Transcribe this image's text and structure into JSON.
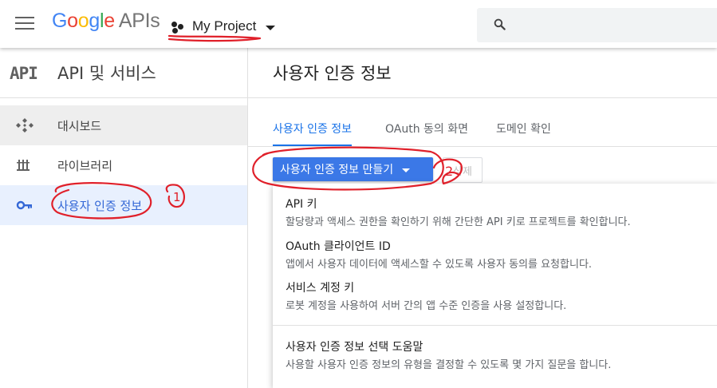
{
  "topbar": {
    "brand": {
      "letters": [
        "G",
        "o",
        "o",
        "g",
        "l",
        "e"
      ],
      "colors": [
        "#4285F4",
        "#EA4335",
        "#FBBC05",
        "#4285F4",
        "#34A853",
        "#EA4335"
      ],
      "suffix": "APIs"
    },
    "project_name": "My Project",
    "menu_icon": "hamburger-menu-icon",
    "search_icon": "search-icon"
  },
  "sidebar": {
    "badge": "API",
    "title": "API 및 서비스",
    "items": [
      {
        "label": "대시보드",
        "icon": "dashboard-icon"
      },
      {
        "label": "라이브러리",
        "icon": "library-icon"
      },
      {
        "label": "사용자 인증 정보",
        "icon": "key-icon"
      }
    ]
  },
  "main": {
    "page_title": "사용자 인증 정보",
    "tabs": [
      {
        "label": "사용자 인증 정보"
      },
      {
        "label": "OAuth 동의 화면"
      },
      {
        "label": "도메인 확인"
      }
    ],
    "create_button": "사용자 인증 정보 만들기",
    "delete_button": "삭제"
  },
  "menu": {
    "items": [
      {
        "title": "API 키",
        "desc": "할당량과 액세스 권한을 확인하기 위해 간단한 API 키로 프로젝트를 확인합니다."
      },
      {
        "title": "OAuth 클라이언트 ID",
        "desc": "앱에서 사용자 데이터에 액세스할 수 있도록 사용자 동의를 요청합니다."
      },
      {
        "title": "서비스 계정 키",
        "desc": "로봇 계정을 사용하여 서버 간의 앱 수준 인증을 사용 설정합니다."
      },
      {
        "title": "사용자 인증 정보 선택 도움말",
        "desc": "사용할 사용자 인증 정보의 유형을 결정할 수 있도록 몇 가지 질문을 합니다."
      }
    ]
  },
  "annotations": {
    "color": "#e0202a",
    "step1": "1",
    "step2": "2"
  }
}
